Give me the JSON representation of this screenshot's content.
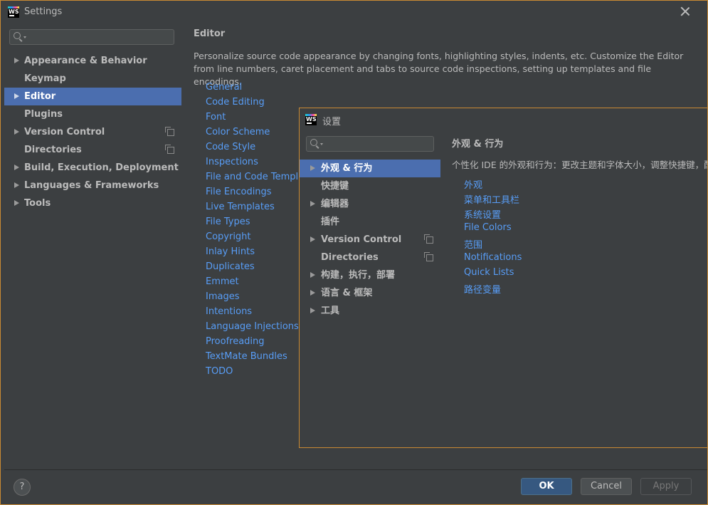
{
  "window": {
    "title": "Settings",
    "logo_text": "WS",
    "colors": {
      "accent": "#4b6eaf",
      "link": "#589df6",
      "background": "#3c3f41",
      "border": "#c98a33",
      "primary_button": "#365880"
    }
  },
  "sidebar": {
    "search_placeholder": "",
    "items": [
      {
        "label": "Appearance & Behavior",
        "has_children": true,
        "selected": false
      },
      {
        "label": "Keymap",
        "has_children": false,
        "selected": false
      },
      {
        "label": "Editor",
        "has_children": true,
        "selected": true
      },
      {
        "label": "Plugins",
        "has_children": false,
        "selected": false
      },
      {
        "label": "Version Control",
        "has_children": true,
        "selected": false,
        "project_icon": "copy-icon"
      },
      {
        "label": "Directories",
        "has_children": false,
        "selected": false,
        "project_icon": "copy-icon"
      },
      {
        "label": "Build, Execution, Deployment",
        "has_children": true,
        "selected": false
      },
      {
        "label": "Languages & Frameworks",
        "has_children": true,
        "selected": false
      },
      {
        "label": "Tools",
        "has_children": true,
        "selected": false
      }
    ]
  },
  "main": {
    "title": "Editor",
    "description": "Personalize source code appearance by changing fonts, highlighting styles, indents, etc. Customize the Editor from line numbers, caret placement and tabs to source code inspections, setting up templates and file encodings.",
    "links": [
      "General",
      "Code Editing",
      "Font",
      "Color Scheme",
      "Code Style",
      "Inspections",
      "File and Code Templates",
      "File Encodings",
      "Live Templates",
      "File Types",
      "Copyright",
      "Inlay Hints",
      "Duplicates",
      "Emmet",
      "Images",
      "Intentions",
      "Language Injections",
      "Proofreading",
      "TextMate Bundles",
      "TODO"
    ]
  },
  "footer": {
    "help_label": "?",
    "ok_label": "OK",
    "cancel_label": "Cancel",
    "apply_label": "Apply"
  },
  "dialog": {
    "title": "设置",
    "logo_text": "WS",
    "search_placeholder": "",
    "items": [
      {
        "label": "外观 & 行为",
        "has_children": true,
        "selected": true
      },
      {
        "label": "快捷键",
        "has_children": false,
        "selected": false
      },
      {
        "label": "编辑器",
        "has_children": true,
        "selected": false
      },
      {
        "label": "插件",
        "has_children": false,
        "selected": false
      },
      {
        "label": "Version Control",
        "has_children": true,
        "selected": false,
        "project_icon": "copy-icon"
      },
      {
        "label": "Directories",
        "has_children": false,
        "selected": false,
        "project_icon": "copy-icon"
      },
      {
        "label": "构建，执行，部署",
        "has_children": true,
        "selected": false
      },
      {
        "label": "语言 & 框架",
        "has_children": true,
        "selected": false
      },
      {
        "label": "工具",
        "has_children": true,
        "selected": false
      }
    ],
    "main": {
      "title": "外观 & 行为",
      "description": "个性化 IDE 的外观和行为：更改主题和字体大小，调整快捷键，配置",
      "links": [
        "外观",
        "菜单和工具栏",
        "系统设置",
        "File Colors",
        "范围",
        "Notifications",
        "Quick Lists",
        "路径变量"
      ]
    }
  }
}
